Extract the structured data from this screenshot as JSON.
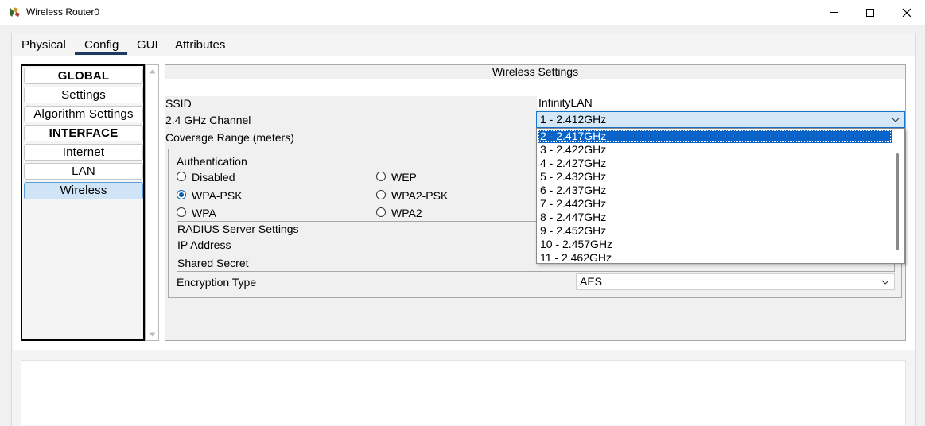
{
  "window": {
    "title": "Wireless Router0",
    "controls": [
      "minimize-icon",
      "maximize-icon",
      "close-icon"
    ]
  },
  "tabs": [
    {
      "label": "Physical"
    },
    {
      "label": "Config",
      "active": true
    },
    {
      "label": "GUI"
    },
    {
      "label": "Attributes"
    }
  ],
  "sidebar": {
    "items": [
      {
        "label": "GLOBAL",
        "header": true
      },
      {
        "label": "Settings"
      },
      {
        "label": "Algorithm Settings"
      },
      {
        "label": "INTERFACE",
        "header": true
      },
      {
        "label": "Internet"
      },
      {
        "label": "LAN"
      },
      {
        "label": "Wireless",
        "selected": true
      }
    ]
  },
  "wireless": {
    "header": "Wireless Settings",
    "ssid_label": "SSID",
    "ssid_value": "InfinityLAN",
    "channel_label": "2.4 GHz Channel",
    "channel_value": "1 - 2.412GHz",
    "coverage_label": "Coverage Range (meters)",
    "auth": {
      "title": "Authentication",
      "options": [
        {
          "label": "Disabled",
          "checked": false
        },
        {
          "label": "WEP",
          "checked": false
        },
        {
          "label": "WPA-PSK",
          "checked": true
        },
        {
          "label": "WPA2-PSK",
          "checked": false
        },
        {
          "label": "WPA",
          "checked": false
        },
        {
          "label": "WPA2",
          "checked": false
        }
      ]
    },
    "radius": {
      "title": "RADIUS Server Settings",
      "ip_label": "IP Address",
      "secret_label": "Shared Secret"
    },
    "encryption_label": "Encryption Type",
    "encryption_value": "AES"
  },
  "channel_dropdown": {
    "options": [
      "2 - 2.417GHz",
      "3 - 2.422GHz",
      "4 - 2.427GHz",
      "5 - 2.432GHz",
      "6 - 2.437GHz",
      "7 - 2.442GHz",
      "8 - 2.447GHz",
      "9 - 2.452GHz",
      "10 - 2.457GHz",
      "11 - 2.462GHz"
    ],
    "highlighted": "2 - 2.417GHz"
  },
  "colors": {
    "accent": "#0a64c8",
    "selection_bg": "#cfe4f7",
    "tab_underline": "#1f3a5f"
  }
}
